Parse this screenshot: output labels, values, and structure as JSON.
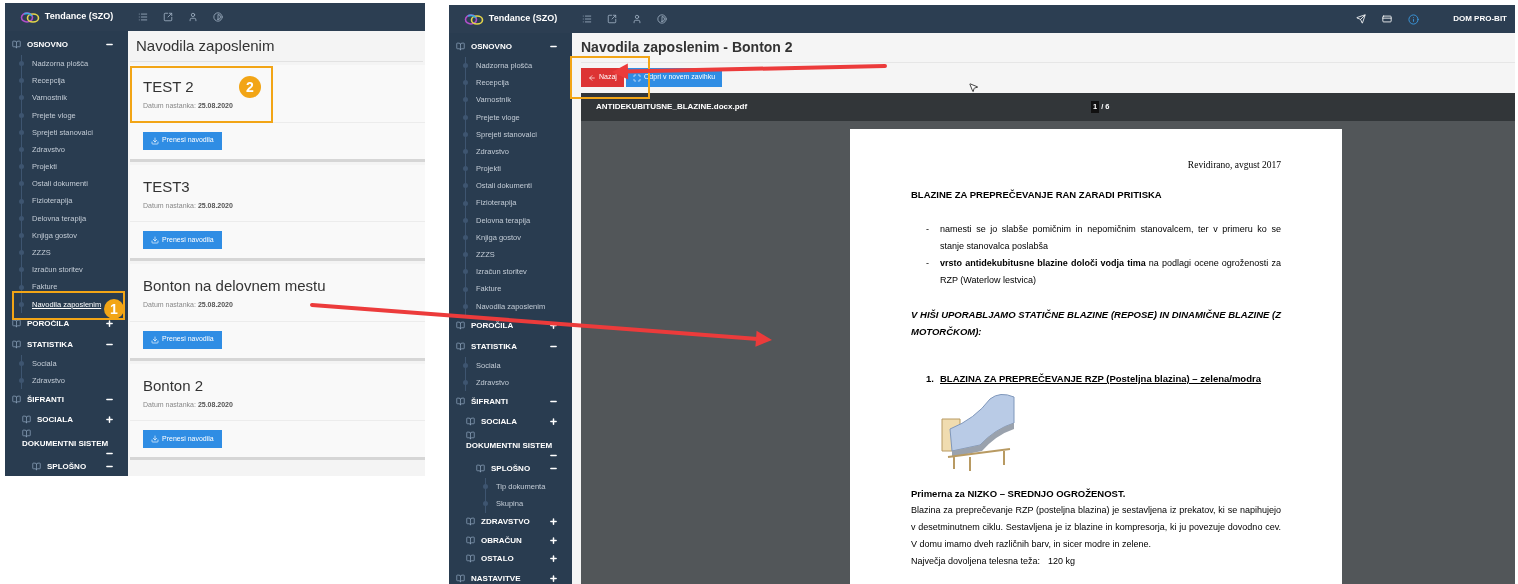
{
  "left_screen": {
    "brand": "Tendance (SZO)",
    "sidebar": [
      {
        "kind": "group",
        "label": "OSNOVNO",
        "expanded": true,
        "children": [
          {
            "kind": "link",
            "label": "Nadzorna plošča",
            "selected": false
          },
          {
            "kind": "link",
            "label": "Recepcija",
            "selected": false
          },
          {
            "kind": "link",
            "label": "Varnostnik",
            "selected": false
          },
          {
            "kind": "link",
            "label": "Prejete vloge",
            "selected": false
          },
          {
            "kind": "link",
            "label": "Sprejeti stanovalci",
            "selected": false
          },
          {
            "kind": "link",
            "label": "Zdravstvo",
            "selected": false
          },
          {
            "kind": "link",
            "label": "Projekti",
            "selected": false
          },
          {
            "kind": "link",
            "label": "Ostali dokumenti",
            "selected": false
          },
          {
            "kind": "link",
            "label": "Fizioterapija",
            "selected": false
          },
          {
            "kind": "link",
            "label": "Delovna terapija",
            "selected": false
          },
          {
            "kind": "link",
            "label": "Knjiga gostov",
            "selected": false
          },
          {
            "kind": "link",
            "label": "ZZZS",
            "selected": false
          },
          {
            "kind": "link",
            "label": "Izračun storitev",
            "selected": false
          },
          {
            "kind": "link",
            "label": "Fakture",
            "selected": false
          },
          {
            "kind": "link",
            "label": "Navodila zaposlenim",
            "selected": true
          }
        ]
      },
      {
        "kind": "group",
        "label": "POROČILA",
        "expanded": false
      },
      {
        "kind": "group",
        "label": "STATISTIKA",
        "expanded": true,
        "children": [
          {
            "kind": "link",
            "label": "Sociala",
            "selected": false
          },
          {
            "kind": "link",
            "label": "Zdravstvo",
            "selected": false
          }
        ]
      },
      {
        "kind": "group",
        "label": "ŠIFRANTI",
        "expanded": true,
        "children": [
          {
            "kind": "group",
            "label": "SOCIALA",
            "expanded": false
          },
          {
            "kind": "group",
            "label": "DOKUMENTNI SISTEM",
            "expanded": true,
            "children": [
              {
                "kind": "group",
                "label": "SPLOŠNO",
                "expanded": true
              }
            ]
          }
        ]
      }
    ],
    "page_title": "Navodila zaposlenim",
    "cards": [
      {
        "title": "TEST 2",
        "date_label": "Datum nastanka:",
        "date": "25.08.2020",
        "button": "Prenesi navodila"
      },
      {
        "title": "TEST3",
        "date_label": "Datum nastanka:",
        "date": "25.08.2020",
        "button": "Prenesi navodila"
      },
      {
        "title": "Bonton na delovnem mestu",
        "date_label": "Datum nastanka:",
        "date": "25.08.2020",
        "button": "Prenesi navodila"
      },
      {
        "title": "Bonton 2",
        "date_label": "Datum nastanka:",
        "date": "25.08.2020",
        "button": "Prenesi navodila"
      }
    ]
  },
  "right_screen": {
    "brand": "Tendance (SZO)",
    "user": "DOM PRO-BIT",
    "sidebar": [
      {
        "kind": "group",
        "label": "OSNOVNO",
        "expanded": true,
        "children": [
          {
            "kind": "link",
            "label": "Nadzorna plošča",
            "selected": false
          },
          {
            "kind": "link",
            "label": "Recepcija",
            "selected": false
          },
          {
            "kind": "link",
            "label": "Varnostnik",
            "selected": false
          },
          {
            "kind": "link",
            "label": "Prejete vloge",
            "selected": false
          },
          {
            "kind": "link",
            "label": "Sprejeti stanovalci",
            "selected": false
          },
          {
            "kind": "link",
            "label": "Zdravstvo",
            "selected": false
          },
          {
            "kind": "link",
            "label": "Projekti",
            "selected": false
          },
          {
            "kind": "link",
            "label": "Ostali dokumenti",
            "selected": false
          },
          {
            "kind": "link",
            "label": "Fizioterapija",
            "selected": false
          },
          {
            "kind": "link",
            "label": "Delovna terapija",
            "selected": false
          },
          {
            "kind": "link",
            "label": "Knjiga gostov",
            "selected": false
          },
          {
            "kind": "link",
            "label": "ZZZS",
            "selected": false
          },
          {
            "kind": "link",
            "label": "Izračun storitev",
            "selected": false
          },
          {
            "kind": "link",
            "label": "Fakture",
            "selected": false
          },
          {
            "kind": "link",
            "label": "Navodila zaposlenim",
            "selected": false
          }
        ]
      },
      {
        "kind": "group",
        "label": "POROČILA",
        "expanded": false
      },
      {
        "kind": "group",
        "label": "STATISTIKA",
        "expanded": true,
        "children": [
          {
            "kind": "link",
            "label": "Sociala",
            "selected": false
          },
          {
            "kind": "link",
            "label": "Zdravstvo",
            "selected": false
          }
        ]
      },
      {
        "kind": "group",
        "label": "ŠIFRANTI",
        "expanded": true,
        "children": [
          {
            "kind": "group",
            "label": "SOCIALA",
            "expanded": false
          },
          {
            "kind": "group",
            "label": "DOKUMENTNI SISTEM",
            "expanded": true,
            "children": [
              {
                "kind": "group",
                "label": "SPLOŠNO",
                "expanded": true,
                "children": [
                  {
                    "kind": "link",
                    "label": "Tip dokumenta",
                    "selected": false
                  },
                  {
                    "kind": "link",
                    "label": "Skupina",
                    "selected": false
                  }
                ]
              }
            ]
          },
          {
            "kind": "group",
            "label": "ZDRAVSTVO",
            "expanded": false
          },
          {
            "kind": "group",
            "label": "OBRAČUN",
            "expanded": false
          },
          {
            "kind": "group",
            "label": "OSTALO",
            "expanded": false
          }
        ]
      },
      {
        "kind": "group",
        "label": "NASTAVITVE",
        "expanded": false
      }
    ],
    "page_title": "Navodila zaposlenim - Bonton 2",
    "buttons": [
      {
        "label": "Nazaj",
        "kind": "back"
      },
      {
        "label": "Odpri v novem zavihku",
        "kind": "open"
      }
    ],
    "viewer": {
      "filename": "ANTIDEKUBITUSNE_BLAZINE.docx.pdf",
      "page_current": "1",
      "page_total": "/ 6",
      "document": [
        {
          "kind": "date",
          "text": "Revidirano, avgust 2017"
        },
        {
          "kind": "heading",
          "text": "BLAZINE ZA PREPREČEVANJE RAN ZARADI PRITISKA"
        },
        {
          "kind": "bullet",
          "marker": "-",
          "text": "namesti se jo slabše pomičnim in nepomičnim stanovalcem, ter v primeru ko se stanje stanovalca poslabša"
        },
        {
          "kind": "bullet",
          "marker": "-",
          "text": "**vrsto antidekubitusne blazine določi vodja tima** na podlagi ocene ogroženosti za RZP (Waterlow lestvica)"
        },
        {
          "kind": "italic_heading",
          "text": "V HIŠI UPORABLJAMO STATIČNE BLAZINE (REPOSE) IN DINAMIČNE BLAZINE (Z MOTORČKOM):"
        },
        {
          "kind": "numbered",
          "number": "1.",
          "text": "BLAZINA ZA PREPREČEVANJE RZP (Posteljna blazina) – zelena/modra"
        },
        {
          "kind": "image"
        },
        {
          "kind": "subheading",
          "text": "Primerna za NIZKO – SREDNJO OGROŽENOST."
        },
        {
          "kind": "paragraph",
          "text": "Blazina za preprečevanje RZP (posteljna blazina)  je sestavljena iz prekatov, ki se napihujejo v desetminutnem ciklu. Sestavljena je iz blazine in kompresorja, ki ju povezuje dovodno cev. V domu imamo dveh različnih barv, in sicer modre in zelene."
        },
        {
          "kind": "weight",
          "label": "Največja dovoljena telesna teža:",
          "value": "120 kg"
        }
      ]
    }
  },
  "callouts": [
    {
      "number": "1"
    },
    {
      "number": "2"
    }
  ]
}
